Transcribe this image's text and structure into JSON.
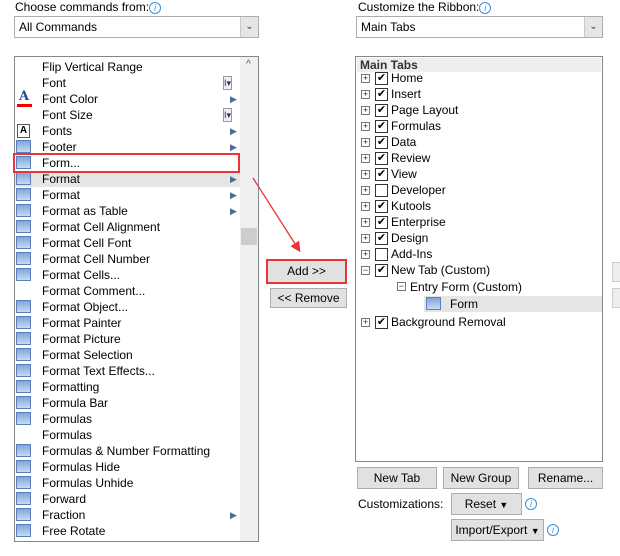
{
  "left": {
    "label": "Choose commands from:",
    "combo_value": "All Commands",
    "items": [
      {
        "label": "Flip Vertical Range",
        "icon": "none",
        "sub": ""
      },
      {
        "label": "Font",
        "icon": "none",
        "sub": "text-cursor-dropdown"
      },
      {
        "label": "Font Color",
        "icon": "font-color-icon",
        "sub": "arrow"
      },
      {
        "label": "Font Size",
        "icon": "none",
        "sub": "text-cursor-dropdown"
      },
      {
        "label": "Fonts",
        "icon": "fonts-icon",
        "sub": "arrow"
      },
      {
        "label": "Footer",
        "icon": "footer-icon",
        "sub": "arrow"
      },
      {
        "label": "Form...",
        "icon": "form-icon",
        "sub": ""
      },
      {
        "label": "Format",
        "icon": "format-icon",
        "sub": "arrow"
      },
      {
        "label": "Format",
        "icon": "format-grid-icon",
        "sub": "arrow"
      },
      {
        "label": "Format as Table",
        "icon": "table-icon",
        "sub": "arrow"
      },
      {
        "label": "Format Cell Alignment",
        "icon": "alignment-icon",
        "sub": ""
      },
      {
        "label": "Format Cell Font",
        "icon": "font-icon",
        "sub": ""
      },
      {
        "label": "Format Cell Number",
        "icon": "percent-icon",
        "sub": ""
      },
      {
        "label": "Format Cells...",
        "icon": "cells-icon",
        "sub": ""
      },
      {
        "label": "Format Comment...",
        "icon": "none",
        "sub": ""
      },
      {
        "label": "Format Object...",
        "icon": "object-icon",
        "sub": ""
      },
      {
        "label": "Format Painter",
        "icon": "painter-icon",
        "sub": ""
      },
      {
        "label": "Format Picture",
        "icon": "picture-icon",
        "sub": ""
      },
      {
        "label": "Format Selection",
        "icon": "selection-icon",
        "sub": ""
      },
      {
        "label": "Format Text Effects...",
        "icon": "text-effects-icon",
        "sub": ""
      },
      {
        "label": "Formatting",
        "icon": "formatting-icon",
        "sub": ""
      },
      {
        "label": "Formula Bar",
        "icon": "check-icon",
        "sub": ""
      },
      {
        "label": "Formulas",
        "icon": "formulas-icon",
        "sub": ""
      },
      {
        "label": "Formulas",
        "icon": "none",
        "sub": ""
      },
      {
        "label": "Formulas & Number Formatting",
        "icon": "number-format-icon",
        "sub": ""
      },
      {
        "label": "Formulas Hide",
        "icon": "hide-icon",
        "sub": ""
      },
      {
        "label": "Formulas Unhide",
        "icon": "unhide-icon",
        "sub": ""
      },
      {
        "label": "Forward",
        "icon": "forward-icon",
        "sub": ""
      },
      {
        "label": "Fraction",
        "icon": "fraction-icon",
        "sub": "arrow"
      },
      {
        "label": "Free Rotate",
        "icon": "rotate-icon",
        "sub": ""
      }
    ]
  },
  "middle": {
    "add_label": "Add >>",
    "remove_label": "<< Remove"
  },
  "right": {
    "label": "Customize the Ribbon:",
    "combo_value": "Main Tabs",
    "header": "Main Tabs",
    "tabs": [
      {
        "label": "Home",
        "checked": true,
        "expanded": false
      },
      {
        "label": "Insert",
        "checked": true,
        "expanded": false
      },
      {
        "label": "Page Layout",
        "checked": true,
        "expanded": false
      },
      {
        "label": "Formulas",
        "checked": true,
        "expanded": false
      },
      {
        "label": "Data",
        "checked": true,
        "expanded": false
      },
      {
        "label": "Review",
        "checked": true,
        "expanded": false
      },
      {
        "label": "View",
        "checked": true,
        "expanded": false
      },
      {
        "label": "Developer",
        "checked": false,
        "expanded": false
      },
      {
        "label": "Kutools",
        "checked": true,
        "expanded": false
      },
      {
        "label": "Enterprise",
        "checked": true,
        "expanded": false
      },
      {
        "label": "Design",
        "checked": true,
        "expanded": false
      },
      {
        "label": "Add-Ins",
        "checked": false,
        "expanded": false
      },
      {
        "label": "New Tab (Custom)",
        "checked": true,
        "expanded": true
      }
    ],
    "group": "Entry Form (Custom)",
    "command": "Form",
    "last_tab": {
      "label": "Background Removal",
      "checked": true
    },
    "new_tab": "New Tab",
    "new_group": "New Group",
    "rename": "Rename...",
    "customizations_label": "Customizations:",
    "reset": "Reset",
    "import_export": "Import/Export"
  },
  "colors": {
    "highlight": "#e8343a",
    "arrow": "#e8343a"
  }
}
